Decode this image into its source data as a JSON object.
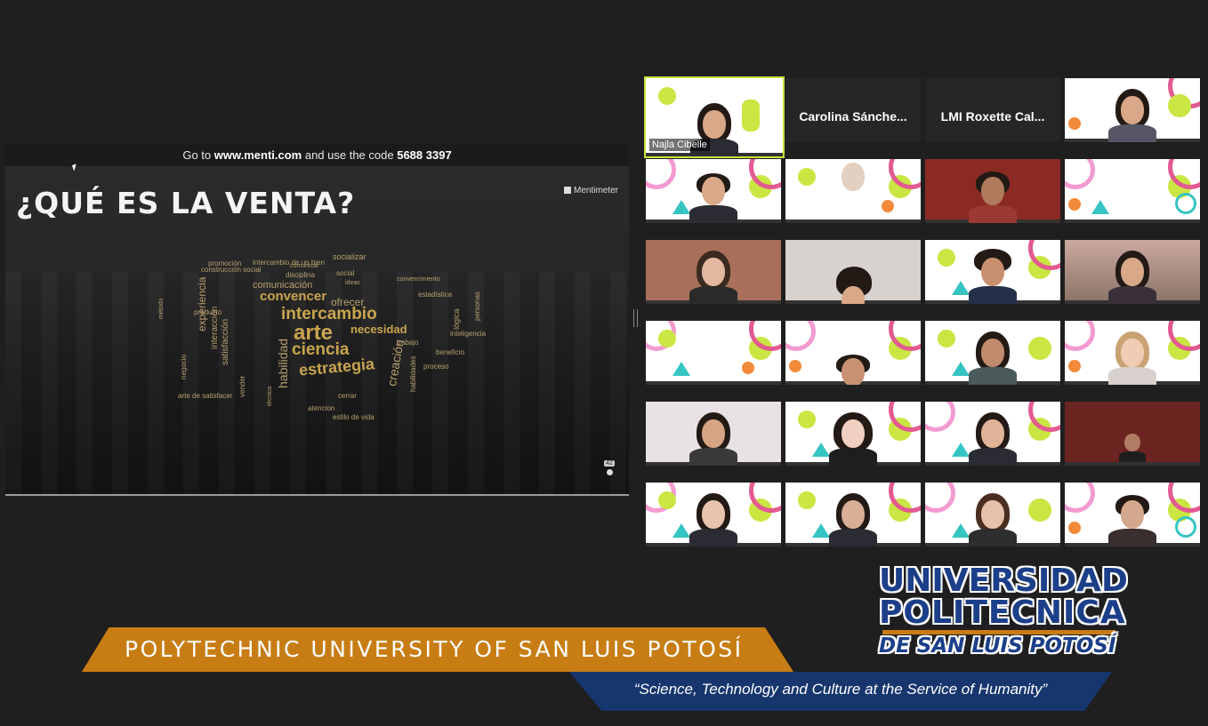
{
  "slide": {
    "instructions_prefix": "Go to ",
    "instructions_url": "www.menti.com",
    "instructions_mid": " and use the code ",
    "instructions_code": "5688 3397",
    "title": "¿QUÉ ES LA VENTA?",
    "brand": "Mentimeter",
    "participant_count": "42",
    "word_cloud": [
      "intercambio de un bien",
      "socializar",
      "promoción",
      "comunicar",
      "construcción social",
      "disciplina",
      "social",
      "comunicación",
      "ideas",
      "convencimiento",
      "estadística",
      "convencer",
      "ofrecer",
      "intercambio",
      "arte",
      "necesidad",
      "ciencia",
      "estrategia",
      "experiencia",
      "satisfacción",
      "habilidad",
      "creación",
      "método",
      "producto",
      "negocio",
      "interacción",
      "lógica",
      "personas",
      "inteligencia",
      "trabajo",
      "beneficio",
      "proceso",
      "habilidades",
      "arte de satisfacer",
      "cerrar",
      "atencion",
      "estilo de vida",
      "vender",
      "técnica"
    ]
  },
  "participants": [
    {
      "name": "Najla Cibelle",
      "type": "video",
      "active": true
    },
    {
      "name": "Carolina  Sánche...",
      "type": "namecard"
    },
    {
      "name": "LMI Roxette Cal...",
      "type": "namecard"
    }
  ],
  "branding": {
    "banner": "POLYTECHNIC UNIVERSITY OF SAN LUIS POTOSÍ",
    "tagline": "“Science, Technology and Culture at the Service of Humanity”",
    "logo_line1": "UNIVERSIDAD",
    "logo_line2": "POLITECNICA",
    "logo_line3": "DE SAN LUIS POTOSÍ"
  },
  "colors": {
    "banner": "#c77d13",
    "tagline_bar": "#17366e",
    "word_cloud": "#c9a54e",
    "active_speaker": "#c7e33a"
  }
}
